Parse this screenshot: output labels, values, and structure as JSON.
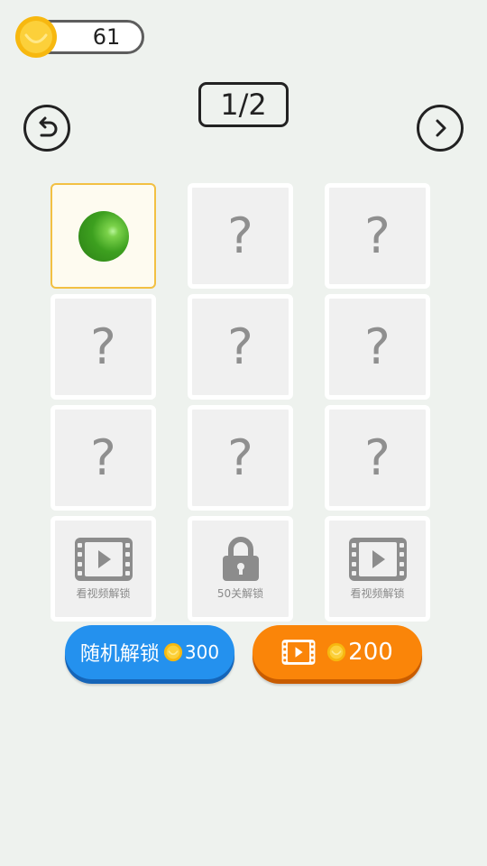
{
  "header": {
    "coin_balance": "61",
    "page_indicator": "1/2"
  },
  "grid": {
    "cells": [
      {
        "type": "ball",
        "color": "#3da01f"
      },
      {
        "type": "unknown",
        "text": "?"
      },
      {
        "type": "unknown",
        "text": "?"
      },
      {
        "type": "unknown",
        "text": "?"
      },
      {
        "type": "unknown",
        "text": "?"
      },
      {
        "type": "unknown",
        "text": "?"
      },
      {
        "type": "unknown",
        "text": "?"
      },
      {
        "type": "unknown",
        "text": "?"
      },
      {
        "type": "unknown",
        "text": "?"
      },
      {
        "type": "video",
        "label": "看视频解锁"
      },
      {
        "type": "lock",
        "label": "50关解锁"
      },
      {
        "type": "video",
        "label": "看视频解锁"
      }
    ]
  },
  "buttons": {
    "random_label": "随机解锁",
    "random_cost": "300",
    "video_cost": "200"
  },
  "colors": {
    "background": "#eef2ee",
    "accent_blue": "#2491ee",
    "accent_orange": "#fa8509",
    "selected_border": "#f2c043"
  }
}
